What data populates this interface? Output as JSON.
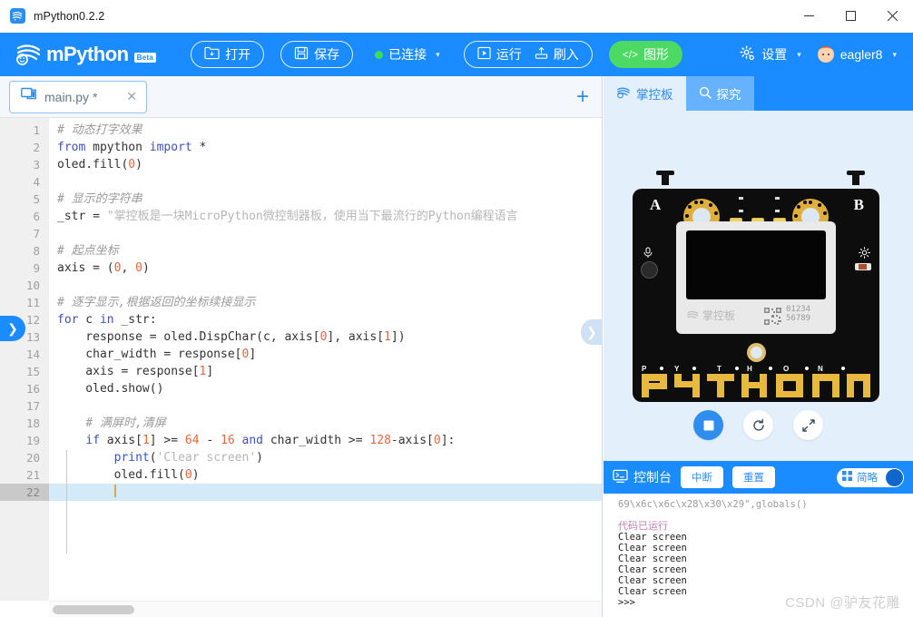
{
  "window": {
    "title": "mPython0.2.2",
    "app_icon": "mpython-logo-icon",
    "minimize": "—",
    "maximize": "□",
    "close": "✕"
  },
  "toolbar": {
    "brand": "mPython",
    "badge": "Beta",
    "open_label": "打开",
    "save_label": "保存",
    "status_label": "已连接",
    "status_color": "#3ddc56",
    "run_label": "运行",
    "flash_label": "刷入",
    "graphic_label": "图形",
    "graphic_prefix": "</>",
    "graphic_color": "#4cd964",
    "settings_label": "设置",
    "user_label": "eagler8",
    "caret": "▾"
  },
  "editor": {
    "tab": {
      "filename": "main.py",
      "dirty": "*",
      "close": "✕"
    },
    "add_tab": "+",
    "current_line": 22,
    "lines": [
      {
        "n": 1,
        "tokens": [
          {
            "t": "cm",
            "v": "# 动态打字效果"
          }
        ]
      },
      {
        "n": 2,
        "tokens": [
          {
            "t": "kw",
            "v": "from"
          },
          {
            "t": "plain",
            "v": " mpython "
          },
          {
            "t": "kw",
            "v": "import"
          },
          {
            "t": "plain",
            "v": " *"
          }
        ]
      },
      {
        "n": 3,
        "tokens": [
          {
            "t": "plain",
            "v": "oled.fill("
          },
          {
            "t": "num",
            "v": "0"
          },
          {
            "t": "plain",
            "v": ")"
          }
        ]
      },
      {
        "n": 4,
        "tokens": []
      },
      {
        "n": 5,
        "tokens": [
          {
            "t": "cm",
            "v": "# 显示的字符串"
          }
        ]
      },
      {
        "n": 6,
        "tokens": [
          {
            "t": "plain",
            "v": "_str = "
          },
          {
            "t": "str",
            "v": "\"掌控板是一块MicroPython微控制器板，使用当下最流行的Python编程语言"
          }
        ]
      },
      {
        "n": 7,
        "tokens": []
      },
      {
        "n": 8,
        "tokens": [
          {
            "t": "cm",
            "v": "# 起点坐标"
          }
        ]
      },
      {
        "n": 9,
        "tokens": [
          {
            "t": "plain",
            "v": "axis = ("
          },
          {
            "t": "num",
            "v": "0"
          },
          {
            "t": "plain",
            "v": ", "
          },
          {
            "t": "num",
            "v": "0"
          },
          {
            "t": "plain",
            "v": ")"
          }
        ]
      },
      {
        "n": 10,
        "tokens": []
      },
      {
        "n": 11,
        "tokens": [
          {
            "t": "cm",
            "v": "# 逐字显示,根据返回的坐标续接显示"
          }
        ]
      },
      {
        "n": 12,
        "tokens": [
          {
            "t": "kw",
            "v": "for"
          },
          {
            "t": "plain",
            "v": " c "
          },
          {
            "t": "kw",
            "v": "in"
          },
          {
            "t": "plain",
            "v": " _str:"
          }
        ]
      },
      {
        "n": 13,
        "tokens": [
          {
            "t": "plain",
            "v": "    response = oled.DispChar(c, axis["
          },
          {
            "t": "num",
            "v": "0"
          },
          {
            "t": "plain",
            "v": "], axis["
          },
          {
            "t": "num",
            "v": "1"
          },
          {
            "t": "plain",
            "v": "])"
          }
        ]
      },
      {
        "n": 14,
        "tokens": [
          {
            "t": "plain",
            "v": "    char_width = response["
          },
          {
            "t": "num",
            "v": "0"
          },
          {
            "t": "plain",
            "v": "]"
          }
        ]
      },
      {
        "n": 15,
        "tokens": [
          {
            "t": "plain",
            "v": "    axis = response["
          },
          {
            "t": "num",
            "v": "1"
          },
          {
            "t": "plain",
            "v": "]"
          }
        ]
      },
      {
        "n": 16,
        "tokens": [
          {
            "t": "plain",
            "v": "    oled.show()"
          }
        ]
      },
      {
        "n": 17,
        "tokens": []
      },
      {
        "n": 18,
        "tokens": [
          {
            "t": "plain",
            "v": "    "
          },
          {
            "t": "cm",
            "v": "# 满屏时,清屏"
          }
        ]
      },
      {
        "n": 19,
        "tokens": [
          {
            "t": "plain",
            "v": "    "
          },
          {
            "t": "kw",
            "v": "if"
          },
          {
            "t": "plain",
            "v": " axis["
          },
          {
            "t": "num",
            "v": "1"
          },
          {
            "t": "plain",
            "v": "] >= "
          },
          {
            "t": "num",
            "v": "64"
          },
          {
            "t": "plain",
            "v": " - "
          },
          {
            "t": "num",
            "v": "16"
          },
          {
            "t": "plain",
            "v": " "
          },
          {
            "t": "kw",
            "v": "and"
          },
          {
            "t": "plain",
            "v": " char_width >= "
          },
          {
            "t": "num",
            "v": "128"
          },
          {
            "t": "plain",
            "v": "-axis["
          },
          {
            "t": "num",
            "v": "0"
          },
          {
            "t": "plain",
            "v": "]:"
          }
        ]
      },
      {
        "n": 20,
        "tokens": [
          {
            "t": "plain",
            "v": "        "
          },
          {
            "t": "fn",
            "v": "print"
          },
          {
            "t": "plain",
            "v": "("
          },
          {
            "t": "str",
            "v": "'Clear screen'"
          },
          {
            "t": "plain",
            "v": ")"
          }
        ]
      },
      {
        "n": 21,
        "tokens": [
          {
            "t": "plain",
            "v": "        oled.fill("
          },
          {
            "t": "num",
            "v": "0"
          },
          {
            "t": "plain",
            "v": ")"
          }
        ]
      },
      {
        "n": 22,
        "tokens": [
          {
            "t": "plain",
            "v": "        "
          }
        ]
      }
    ],
    "left_handle": "❯",
    "right_handle": "❯"
  },
  "simulator": {
    "tabs": [
      {
        "label": "掌控板",
        "icon": "mpython-logo-icon",
        "active": true
      },
      {
        "label": "探究",
        "icon": "search-icon",
        "active": false
      }
    ],
    "board": {
      "button_a": "A",
      "button_b": "B",
      "plate_logo": "掌控板",
      "plate_number_top": "01234",
      "plate_number_bottom": "56789",
      "word": "PYTHON",
      "letters": [
        "P",
        "Y",
        "T",
        "H",
        "O",
        "N"
      ]
    },
    "controls": [
      {
        "name": "stop-button",
        "icon": "stop-square-icon",
        "primary": true
      },
      {
        "name": "reset-button",
        "icon": "reset-circular-arrow-icon",
        "primary": false
      },
      {
        "name": "fullscreen-button",
        "icon": "expand-arrows-icon",
        "primary": false
      }
    ]
  },
  "console": {
    "title": "控制台",
    "interrupt_label": "中断",
    "reset_label": "重置",
    "toggle_label": "简略",
    "toggle_on": true,
    "lines": [
      {
        "text": "69\\x6c\\x6c\\x28\\x30\\x29\",globals()",
        "style": "muted"
      },
      {
        "text": "",
        "style": "plain"
      },
      {
        "text": "代码已运行",
        "style": "zh"
      },
      {
        "text": "Clear screen",
        "style": "plain"
      },
      {
        "text": "Clear screen",
        "style": "plain"
      },
      {
        "text": "Clear screen",
        "style": "plain"
      },
      {
        "text": "Clear screen",
        "style": "plain"
      },
      {
        "text": "Clear screen",
        "style": "plain"
      },
      {
        "text": "Clear screen",
        "style": "plain"
      },
      {
        "text": ">>>",
        "style": "plain"
      }
    ],
    "watermark": "CSDN @驴友花雕"
  }
}
